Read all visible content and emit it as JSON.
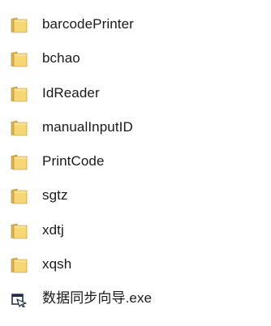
{
  "files": [
    {
      "name": "barcodePrinter",
      "type": "folder",
      "icon": "folder-icon"
    },
    {
      "name": "bchao",
      "type": "folder",
      "icon": "folder-icon"
    },
    {
      "name": "IdReader",
      "type": "folder",
      "icon": "folder-icon"
    },
    {
      "name": "manualInputID",
      "type": "folder",
      "icon": "folder-icon"
    },
    {
      "name": "PrintCode",
      "type": "folder",
      "icon": "folder-icon"
    },
    {
      "name": "sgtz",
      "type": "folder",
      "icon": "folder-icon"
    },
    {
      "name": "xdtj",
      "type": "folder",
      "icon": "folder-icon"
    },
    {
      "name": "xqsh",
      "type": "folder",
      "icon": "folder-icon"
    },
    {
      "name": "数据同步向导.exe",
      "type": "application",
      "icon": "application-icon"
    }
  ],
  "colors": {
    "folder_back": "#e0b24a",
    "folder_front": "#f7d774",
    "folder_edge": "#b8862a",
    "app_icon": "#1f2f4a"
  }
}
